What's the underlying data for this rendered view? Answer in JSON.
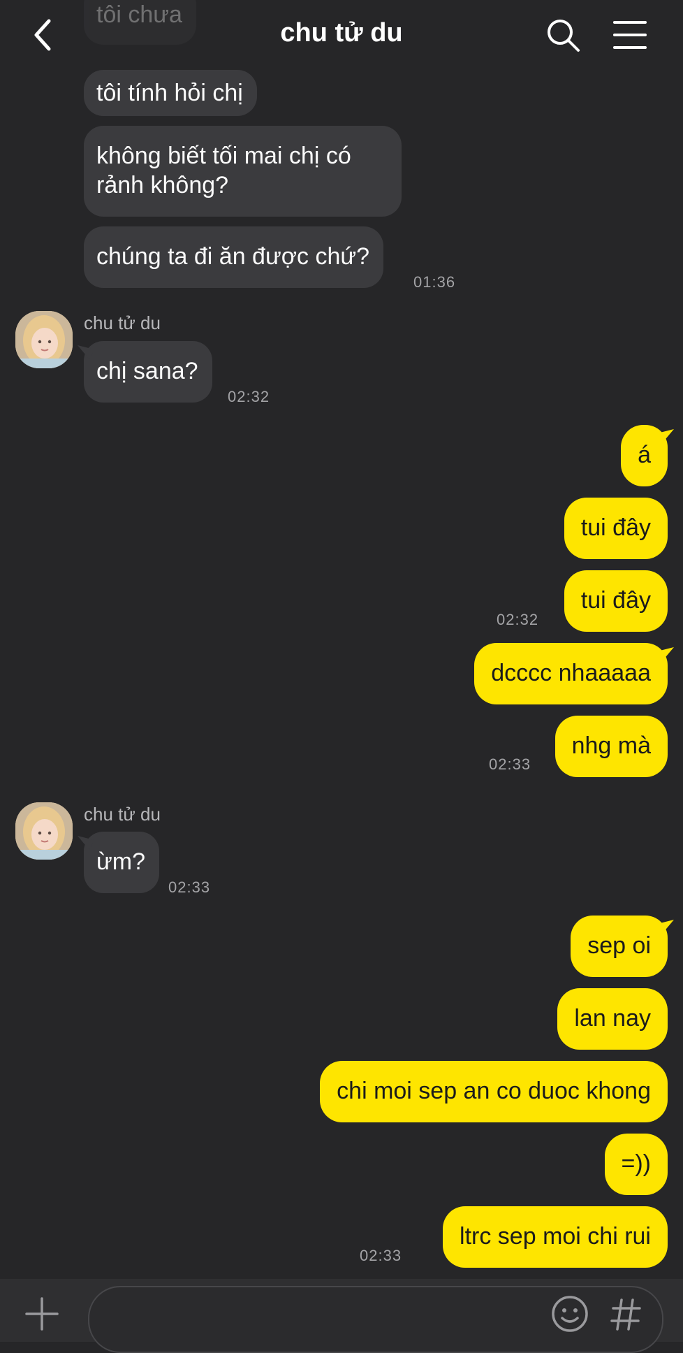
{
  "header": {
    "title": "chu tử du"
  },
  "colors": {
    "background": "#262628",
    "incoming_bubble": "#3b3b3e",
    "outgoing_bubble": "#fee500"
  },
  "icons": {
    "back": "chevron-left-icon",
    "search": "search-icon",
    "menu": "hamburger-menu-icon",
    "add": "plus-icon",
    "emoji": "smiley-icon",
    "hashtag": "hashtag-icon"
  },
  "messages": {
    "m0": "tôi chưa",
    "m1": "tôi tính hỏi chị",
    "m2": "không biết tối mai chị có rảnh không?",
    "m3": "chúng ta đi ăn được chứ?",
    "t3": "01:36",
    "sender1": "chu tử du",
    "m4": "chị sana?",
    "t4": "02:32",
    "o1": "á",
    "o2": "tui đây",
    "o3": "tui đây",
    "t_o3": "02:32",
    "o4": "dcccc nhaaaaa",
    "o5": "nhg mà",
    "t_o5": "02:33",
    "sender2": "chu tử du",
    "m5": "ừm?",
    "t5": "02:33",
    "o6": "sep oi",
    "o7": "lan nay",
    "o8": "chi moi sep an co duoc khong",
    "o9": "=))",
    "o10": "ltrc sep moi chi rui",
    "t_o10": "02:33"
  },
  "input": {
    "placeholder": ""
  }
}
